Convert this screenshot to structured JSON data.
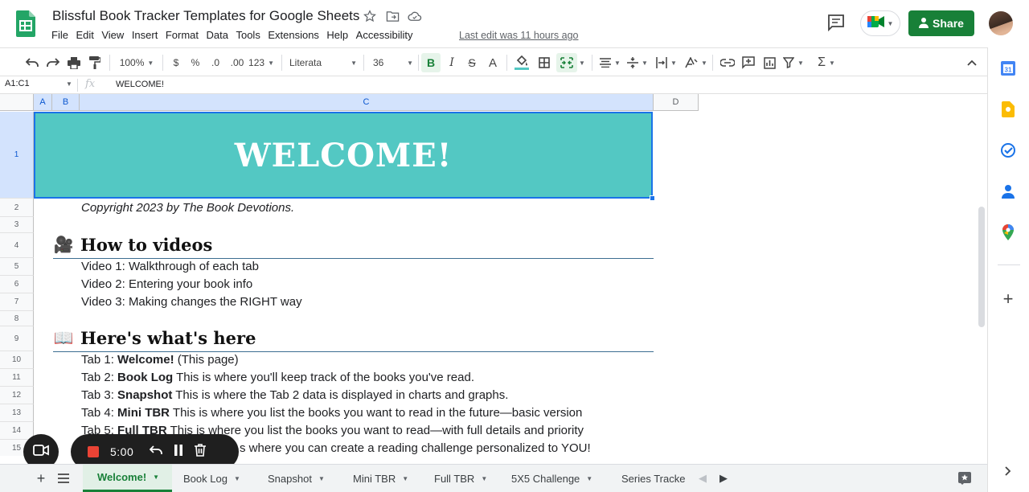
{
  "app": {
    "title": "Blissful Book Tracker Templates for Google Sheets",
    "last_edit": "Last edit was 11 hours ago",
    "share_label": "Share"
  },
  "menu": [
    "File",
    "Edit",
    "View",
    "Insert",
    "Format",
    "Data",
    "Tools",
    "Extensions",
    "Help",
    "Accessibility"
  ],
  "toolbar": {
    "zoom": "100%",
    "currency": "$",
    "percent": "%",
    "dec_decrease": ".0",
    "dec_increase": ".00",
    "more_formats": "123",
    "font": "Literata",
    "font_size": "36",
    "bold": "B",
    "italic": "I",
    "strike": "S",
    "text_color": "A"
  },
  "formula_bar": {
    "name_box": "A1:C1",
    "fx": "fx",
    "formula": "WELCOME!"
  },
  "columns": [
    "A",
    "B",
    "C",
    "D"
  ],
  "rows": [
    "1",
    "2",
    "3",
    "4",
    "5",
    "6",
    "7",
    "8",
    "9",
    "10",
    "11",
    "12",
    "13",
    "14",
    "15"
  ],
  "sheet": {
    "welcome": "WELCOME!",
    "copyright": "Copyright 2023 by The Book Devotions.",
    "section1": {
      "emoji": "🎥",
      "title": "How to videos"
    },
    "videos": [
      "Video 1: Walkthrough of each tab",
      "Video 2: Entering your book info",
      "Video 3: Making changes the RIGHT way"
    ],
    "section2": {
      "emoji": "📖",
      "title": "Here's what's here"
    },
    "tabs_list": [
      {
        "prefix": "Tab 1: ",
        "name": "Welcome!",
        "desc": " (This page)"
      },
      {
        "prefix": "Tab 2: ",
        "name": "Book Log",
        "desc": " This is where you'll keep track of the books you've read."
      },
      {
        "prefix": "Tab 3: ",
        "name": "Snapshot",
        "desc": " This is where the Tab 2 data is displayed in charts and graphs."
      },
      {
        "prefix": "Tab 4: ",
        "name": "Mini TBR",
        "desc": " This is where you list the books you want to read in the future—basic version"
      },
      {
        "prefix": "Tab 5: ",
        "name": "Full TBR",
        "desc": " This is where you list the books you want to read—with full details and priority"
      },
      {
        "prefix": "",
        "name": "",
        "desc": "s where you can create a reading challenge personalized to YOU!"
      }
    ]
  },
  "recorder": {
    "time": "5:00"
  },
  "sheet_tabs": [
    "Welcome!",
    "Book Log",
    "Snapshot",
    "Mini TBR",
    "Full TBR",
    "5X5 Challenge",
    "Series Tracke"
  ],
  "colors": {
    "banner": "#53c8c3",
    "share": "#188038",
    "selection": "#1a73e8",
    "recorder_bg": "#1f1f1f",
    "recorder_stop": "#ea4335"
  }
}
